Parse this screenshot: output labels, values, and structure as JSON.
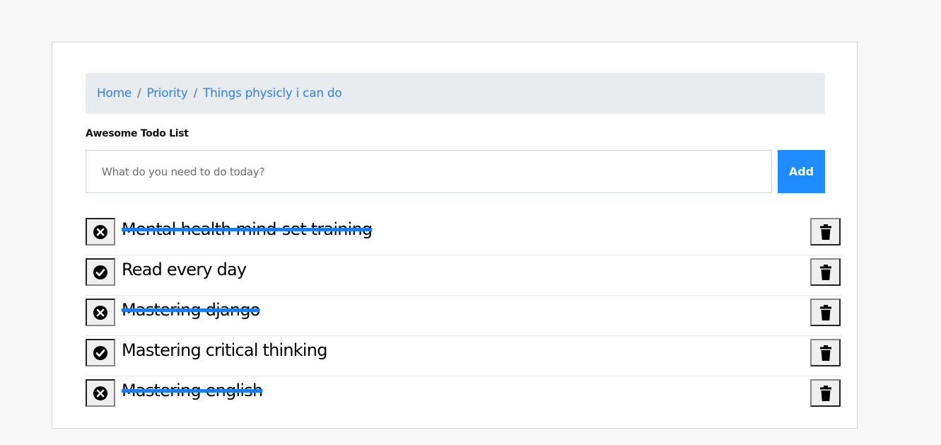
{
  "breadcrumb": {
    "items": [
      "Home",
      "Priority",
      "Things physicly i can do"
    ],
    "separator": "/"
  },
  "list_title": "Awesome Todo List",
  "input": {
    "placeholder": "What do you need to do today?",
    "value": ""
  },
  "add_button_label": "Add",
  "todos": [
    {
      "text": "Mental health mind-set training",
      "done": true
    },
    {
      "text": "Read every day",
      "done": false
    },
    {
      "text": "Mastering django",
      "done": true
    },
    {
      "text": "Mastering critical thinking",
      "done": false
    },
    {
      "text": "Mastering english",
      "done": true
    }
  ],
  "colors": {
    "accent": "#1e8cff",
    "link": "#2f80ed",
    "strike": "#1e7bf0",
    "breadcrumb_bg": "#e9ecef"
  },
  "icons": {
    "done_toggle": "times-circle-icon",
    "undone_toggle": "check-circle-icon",
    "delete": "trash-icon"
  }
}
